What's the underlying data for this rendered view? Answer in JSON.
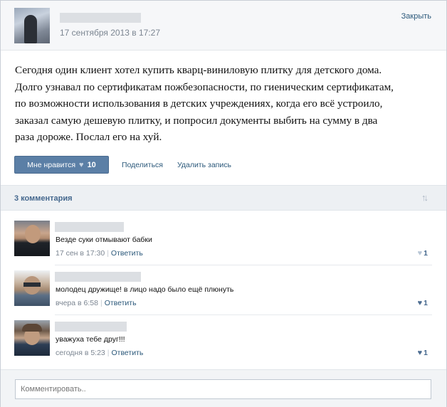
{
  "post": {
    "date": "17 сентября 2013 в 17:27",
    "close_label": "Закрыть",
    "text_lines": [
      "Сегодня один клиент хотел купить кварц-виниловую плитку для детского дома.",
      "Долго узнавал по сертификатам пожбезопасности, по гиеническим сертификатам,",
      "по возможности использования в детских учреждениях, когда его всё устроило,",
      "заказал самую дешевую плитку, и попросил документы выбить на сумму в два",
      "раза дороже. Послал его на хуй."
    ]
  },
  "actions": {
    "like_label": "Мне нравится",
    "like_icon": "heart-icon",
    "like_count": "10",
    "share_label": "Поделиться",
    "delete_label": "Удалить запись"
  },
  "comments_header": {
    "title": "3 комментария",
    "sort_icon": "sort-arrows-icon"
  },
  "comments": [
    {
      "text": "Везде суки отмывают бабки",
      "time": "17 сен в 17:30",
      "reply_label": "Ответить",
      "likes": "1"
    },
    {
      "text": "молодец дружище! в лицо надо было ещё плюнуть",
      "time": "вчера в 6:58",
      "reply_label": "Ответить",
      "likes": "1"
    },
    {
      "text": "уважуха тебе друг!!!",
      "time": "сегодня в 5:23",
      "reply_label": "Ответить",
      "likes": "1"
    }
  ],
  "comment_input": {
    "placeholder": "Комментировать.."
  },
  "colors": {
    "link": "#2b587a",
    "button": "#5b7fa6",
    "header_bg": "#f6f7f9",
    "comments_bar_bg": "#edf0f3"
  }
}
